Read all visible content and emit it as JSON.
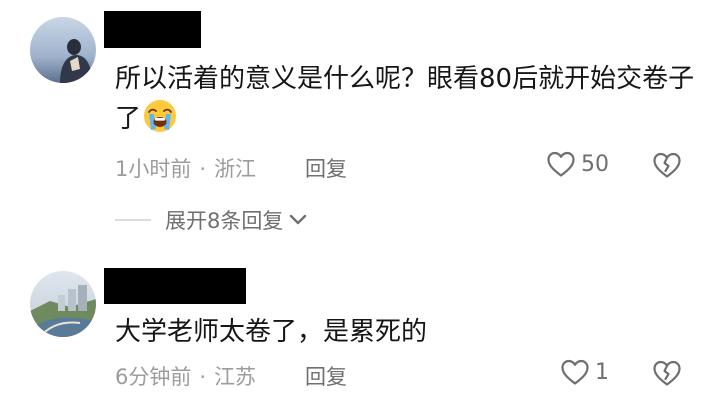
{
  "comments": [
    {
      "text": "所以活着的意义是什么呢？眼看80后就开始交卷子了",
      "emoji": "loudly-crying-face-emoji",
      "time": "1小时前",
      "separator": "·",
      "location": "浙江",
      "reply_label": "回复",
      "likes": "50",
      "expand_label": "展开8条回复"
    },
    {
      "text": "大学老师太卷了，是累死的",
      "time": "6分钟前",
      "separator": "·",
      "location": "江苏",
      "reply_label": "回复",
      "likes": "1"
    }
  ],
  "icons": {
    "like": "heart-outline-icon",
    "dislike": "broken-heart-icon",
    "expand": "chevron-down-icon"
  },
  "colors": {
    "text": "#161616",
    "meta": "#9c9c9c",
    "action": "#6f6f6f"
  }
}
